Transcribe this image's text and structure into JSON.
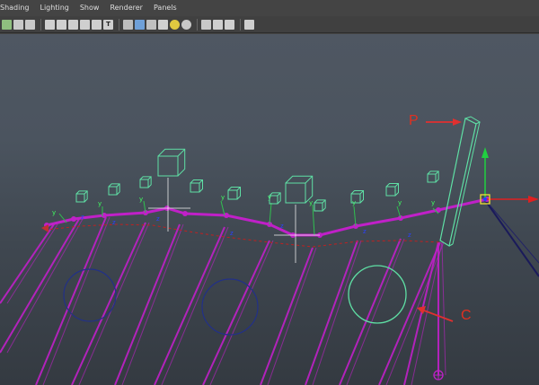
{
  "menubar": {
    "items": [
      "Shading",
      "Lighting",
      "Show",
      "Renderer",
      "Panels"
    ]
  },
  "toolbar": {
    "icons": [
      {
        "name": "camera-attributes-icon",
        "color": "#8fbf7f",
        "glyph": ""
      },
      {
        "name": "bookmark-icon",
        "color": "#c8c8c8",
        "glyph": ""
      },
      {
        "name": "image-plane-icon",
        "color": "#c8c8c8",
        "glyph": ""
      },
      {
        "name": "sep"
      },
      {
        "name": "grid-icon",
        "color": "#d0d0d0",
        "glyph": ""
      },
      {
        "name": "film-gate-icon",
        "color": "#cfcfcf",
        "glyph": ""
      },
      {
        "name": "resolution-gate-icon",
        "color": "#cfcfcf",
        "glyph": ""
      },
      {
        "name": "gate-mask-icon",
        "color": "#cfcfcf",
        "glyph": ""
      },
      {
        "name": "safe-action-icon",
        "color": "#cfcfcf",
        "glyph": ""
      },
      {
        "name": "safe-title-icon",
        "color": "#cfcfcf",
        "glyph": "T"
      },
      {
        "name": "sep"
      },
      {
        "name": "wireframe-icon",
        "color": "#bdbdbd",
        "glyph": ""
      },
      {
        "name": "smooth-shade-icon",
        "color": "#6fa0d8",
        "glyph": ""
      },
      {
        "name": "wireframe-on-shaded-icon",
        "color": "#c0c0c0",
        "glyph": ""
      },
      {
        "name": "textured-icon",
        "color": "#d0d0d0",
        "glyph": ""
      },
      {
        "name": "use-all-lights-icon",
        "color": "#e0c840",
        "glyph": ""
      },
      {
        "name": "shadows-icon",
        "color": "#c8c8c8",
        "glyph": ""
      },
      {
        "name": "sep"
      },
      {
        "name": "isolate-select-icon",
        "color": "#c8c8c8",
        "glyph": ""
      },
      {
        "name": "xray-icon",
        "color": "#cfcfcf",
        "glyph": ""
      },
      {
        "name": "xray-joints-icon",
        "color": "#cfcfcf",
        "glyph": ""
      },
      {
        "name": "sep"
      },
      {
        "name": "xray-components-icon",
        "color": "#cfcfcf",
        "glyph": ""
      }
    ]
  },
  "viewport": {
    "annotations": {
      "p_label": "P",
      "c_label": "C"
    },
    "colors": {
      "curve": "#c020c8",
      "selected": "#40e0a0",
      "ghost": "#5fe0a5",
      "circle": "#223088",
      "red_arrow": "#e03030"
    }
  }
}
